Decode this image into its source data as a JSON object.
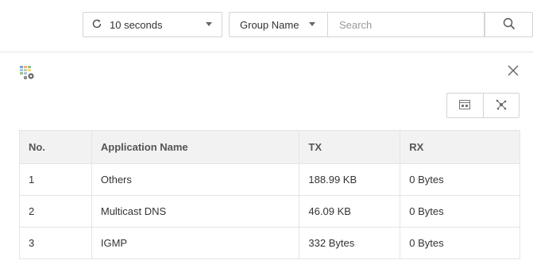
{
  "toolbar": {
    "refresh_interval": "10 seconds",
    "group_filter": "Group Name",
    "search_placeholder": "Search"
  },
  "icons": {
    "refresh": "refresh-icon",
    "search": "search-icon",
    "app_settings": "app-settings-icon",
    "close": "close-icon",
    "table_view": "table-view-icon",
    "topology_view": "topology-view-icon"
  },
  "table": {
    "columns": [
      "No.",
      "Application Name",
      "TX",
      "RX"
    ],
    "rows": [
      {
        "no": "1",
        "app": "Others",
        "tx": "188.99 KB",
        "rx": "0 Bytes"
      },
      {
        "no": "2",
        "app": "Multicast DNS",
        "tx": "46.09 KB",
        "rx": "0 Bytes"
      },
      {
        "no": "3",
        "app": "IGMP",
        "tx": "332 Bytes",
        "rx": "0 Bytes"
      }
    ]
  }
}
